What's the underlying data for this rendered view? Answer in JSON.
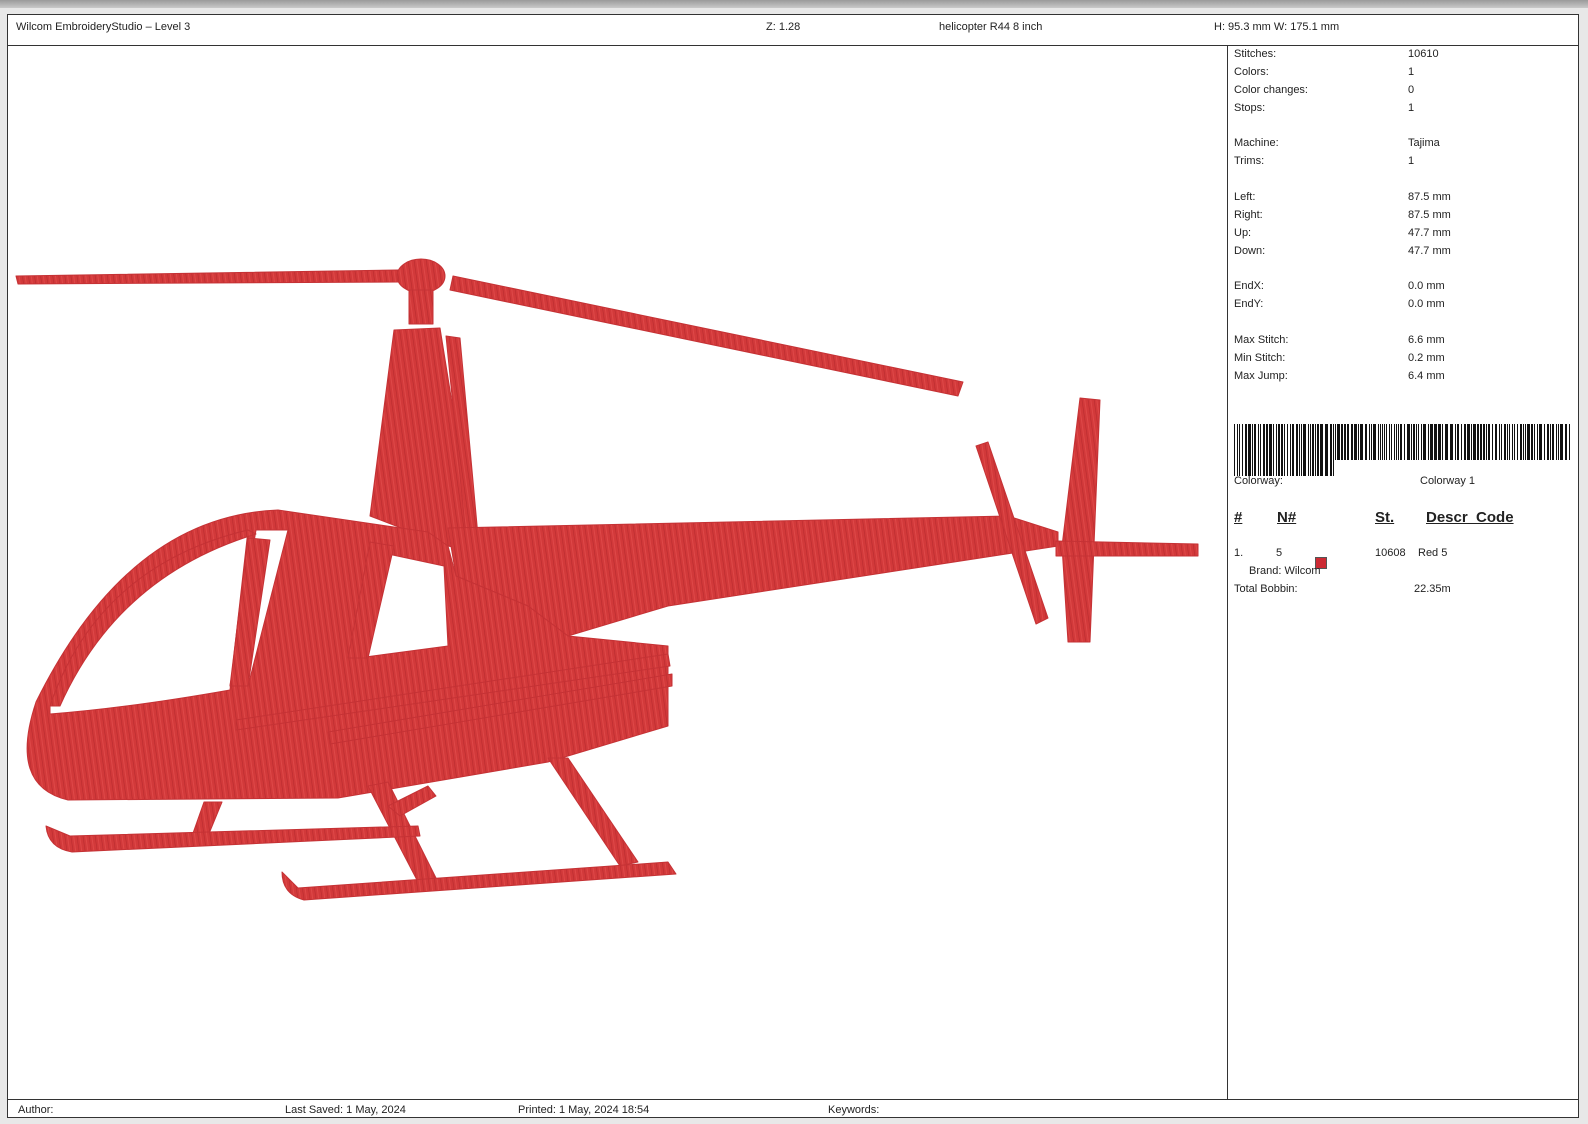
{
  "header": {
    "app_title": "Wilcom EmbroideryStudio – Level 3",
    "zoom": "Z: 1.28",
    "design_name": "helicopter R44 8 inch",
    "dimensions": "H: 95.3 mm  W: 175.1 mm"
  },
  "stats": {
    "stitches": {
      "label": "Stitches:",
      "value": "10610"
    },
    "colors": {
      "label": "Colors:",
      "value": "1"
    },
    "color_changes": {
      "label": "Color changes:",
      "value": "0"
    },
    "stops": {
      "label": "Stops:",
      "value": "1"
    },
    "machine": {
      "label": "Machine:",
      "value": "Tajima"
    },
    "trims": {
      "label": "Trims:",
      "value": "1"
    },
    "left": {
      "label": "Left:",
      "value": "87.5 mm"
    },
    "right": {
      "label": "Right:",
      "value": "87.5 mm"
    },
    "up": {
      "label": "Up:",
      "value": "47.7 mm"
    },
    "down": {
      "label": "Down:",
      "value": "47.7 mm"
    },
    "endx": {
      "label": "EndX:",
      "value": "0.0 mm"
    },
    "endy": {
      "label": "EndY:",
      "value": "0.0 mm"
    },
    "max_stitch": {
      "label": "Max Stitch:",
      "value": "6.6 mm"
    },
    "min_stitch": {
      "label": "Min Stitch:",
      "value": "0.2 mm"
    },
    "max_jump": {
      "label": "Max Jump:",
      "value": "6.4 mm"
    }
  },
  "colorway": {
    "label": "Colorway:",
    "value": "Colorway 1"
  },
  "color_table": {
    "headers": {
      "num": "#",
      "needle": "N#",
      "stitches": "St.",
      "descr": "Descr_Code"
    },
    "rows": [
      {
        "num": "1.",
        "needle": "5",
        "swatch_color": "#cc2a33",
        "stitches": "10608",
        "descr": "Red 5",
        "brand": "Brand: Wilcom"
      }
    ],
    "total_bobbin_label": "Total Bobbin:",
    "total_bobbin_value": "22.35m"
  },
  "footer": {
    "author": "Author:",
    "last_saved": "Last Saved:  1 May, 2024",
    "printed": "Printed:  1 May, 2024 18:54",
    "keywords": "Keywords:"
  },
  "colors": {
    "thread": "#d2393a",
    "border": "#333333"
  }
}
